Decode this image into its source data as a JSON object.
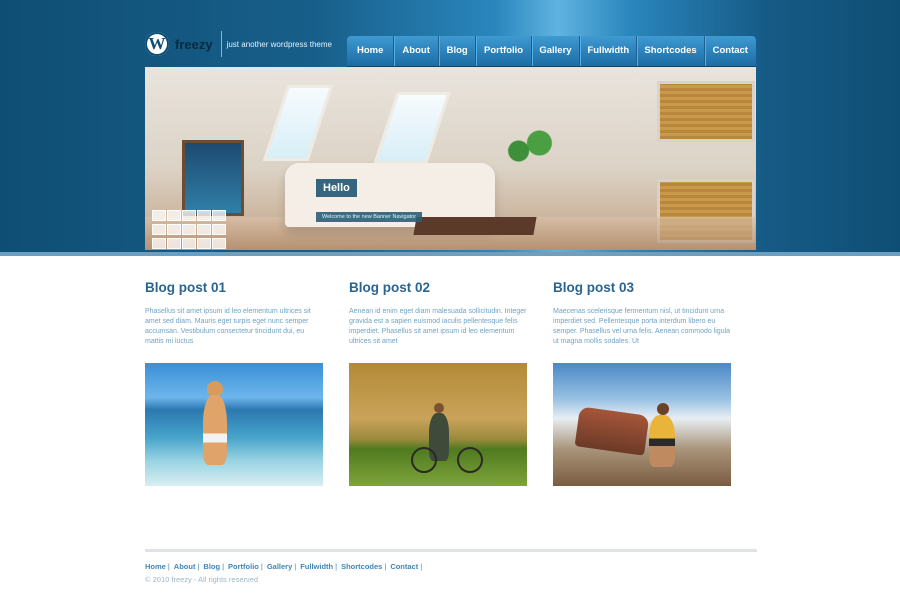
{
  "header": {
    "brand": "freezy",
    "tagline": "just another wordpress theme",
    "logo_icon": "wordpress-logo-icon",
    "logo_letter": "W"
  },
  "nav": {
    "items": [
      "Home",
      "About",
      "Blog",
      "Portfolio",
      "Gallery",
      "Fullwidth",
      "Shortcodes",
      "Contact"
    ]
  },
  "banner": {
    "heading": "Hello",
    "caption": "Welcome to the new Banner Navigator",
    "thumbnail_count": 15
  },
  "posts": [
    {
      "title": "Blog post 01",
      "excerpt": "Phasellus sit amet ipsum id leo elementum ultrices sit amet sed diam. Mauris eget turpis eget nunc semper accumsan. Vestibulum consectetur tincidunt dui, eu mattis mi luctus",
      "image": "woman-in-surf-photo"
    },
    {
      "title": "Blog post 02",
      "excerpt": "Aenean id enim eget diam malesuada sollicitudin. Integer gravida est a sapien euismod iaculis pellentesque felis imperdiet. Phasellus sit amet ipsum id leo elementum ultrices sit amet",
      "image": "woman-with-bicycle-photo"
    },
    {
      "title": "Blog post 03",
      "excerpt": "Maecenas scelerisque fermentum nisl, ut tincidunt urna imperdiet sed. Pellentesque porta interdum libero eu semper. Phasellus vel urna felis. Aenean commodo ligula ut magna mollis sodales. Ut",
      "image": "woman-by-old-car-photo"
    }
  ],
  "footer": {
    "links": [
      "Home",
      "About",
      "Blog",
      "Portfolio",
      "Gallery",
      "Fullwidth",
      "Shortcodes",
      "Contact"
    ],
    "separator": "|",
    "copyright": "© 2010 freezy - All rights reserved"
  },
  "colors": {
    "header_blue": "#175f8a",
    "nav_blue": "#2a80bb",
    "heading_blue": "#2a6592",
    "text_light_blue": "#6fa3c5"
  }
}
